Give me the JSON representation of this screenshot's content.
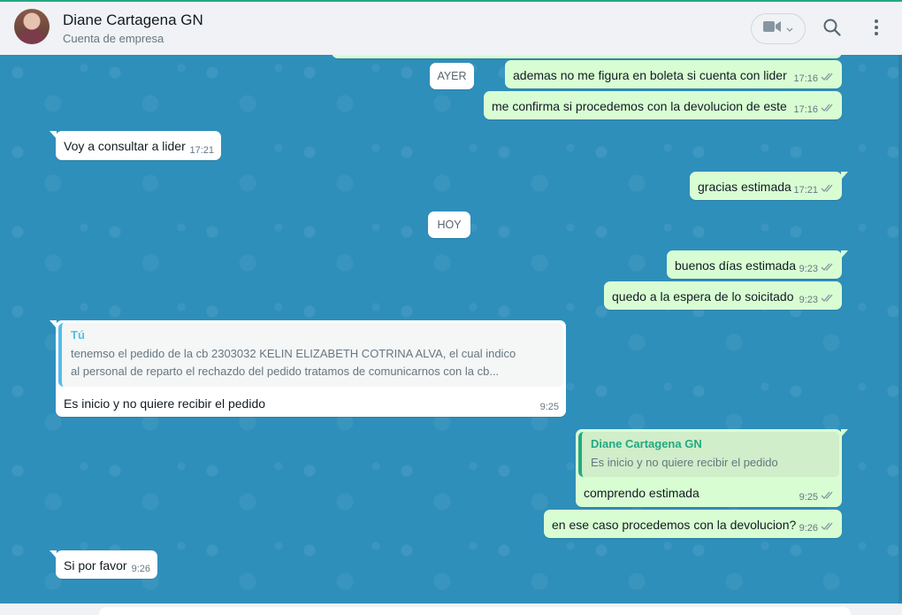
{
  "header": {
    "contact_name": "Diane Cartagena GN",
    "contact_subtitle": "Cuenta de empresa"
  },
  "icons": {
    "video": "video-camera-icon",
    "search": "search-icon",
    "menu": "kebab-menu-icon"
  },
  "colors": {
    "outgoing_bubble": "#d9fdd3",
    "incoming_bubble": "#ffffff",
    "chat_background": "#2f8fbb",
    "quote_self_name": "#53bdeb",
    "quote_contact_name": "#25a884"
  },
  "date_dividers": {
    "yesterday": "AYER",
    "today": "HOY"
  },
  "messages": {
    "m1": {
      "text": "ademas no me figura en boleta si cuenta con lider",
      "time": "17:16"
    },
    "m2": {
      "text": "me confirma si procedemos con la devolucion de este",
      "time": "17:16"
    },
    "m3": {
      "text": "Voy a consultar a lider",
      "time": "17:21"
    },
    "m4": {
      "text": "gracias estimada",
      "time": "17:21"
    },
    "m5": {
      "text": "buenos días estimada",
      "time": "9:23"
    },
    "m6": {
      "text": "quedo a la espera de lo soicitado",
      "time": "9:23"
    },
    "m7": {
      "quote_author": "Tú",
      "quote_line1": "tenemso el pedido de la cb 2303032 KELIN ELIZABETH COTRINA ALVA, el cual indico",
      "quote_line2": "al personal de reparto el rechazdo del pedido tratamos de comunicarnos con la cb...",
      "text": "Es inicio y no quiere recibir el pedido",
      "time": "9:25"
    },
    "m8": {
      "quote_author": "Diane Cartagena GN",
      "quote_line1": "Es inicio y no quiere recibir el pedido",
      "text": "comprendo estimada",
      "time": "9:25"
    },
    "m9": {
      "text": "en ese caso procedemos con la devolucion?",
      "time": "9:26"
    },
    "m10": {
      "text": "Si por favor",
      "time": "9:26"
    }
  }
}
